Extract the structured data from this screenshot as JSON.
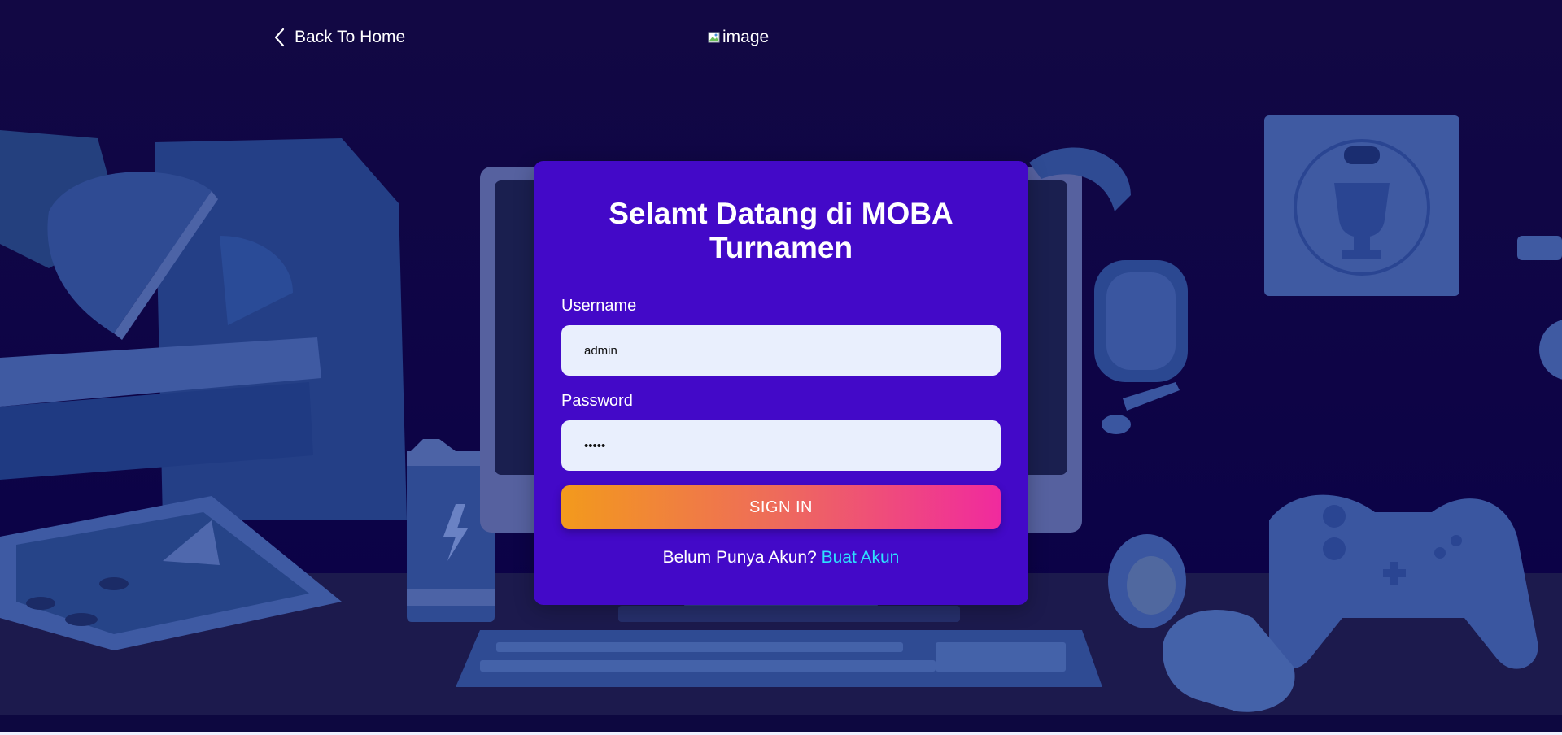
{
  "nav": {
    "back_label": "Back To Home",
    "logo_alt": "image"
  },
  "login": {
    "title_line1": "Selamt Datang di MOBA",
    "title_line2": "Turnamen",
    "username_label": "Username",
    "username_value": "admin",
    "password_label": "Password",
    "password_value": "•••••",
    "signin_label": "SIGN IN",
    "signup_prompt": "Belum Punya Akun?",
    "signup_link": "Buat Akun"
  },
  "colors": {
    "background": "#0c0543",
    "card": "#4309c8",
    "input_bg": "#e9effd",
    "button_gradient_start": "#f39a1c",
    "button_gradient_end": "#f02a9e",
    "link": "#2ee0ff"
  },
  "icons": {
    "back": "chevron-left-icon",
    "power": "lightning-icon",
    "trophy": "trophy-icon",
    "controller": "gamepad-icon"
  }
}
